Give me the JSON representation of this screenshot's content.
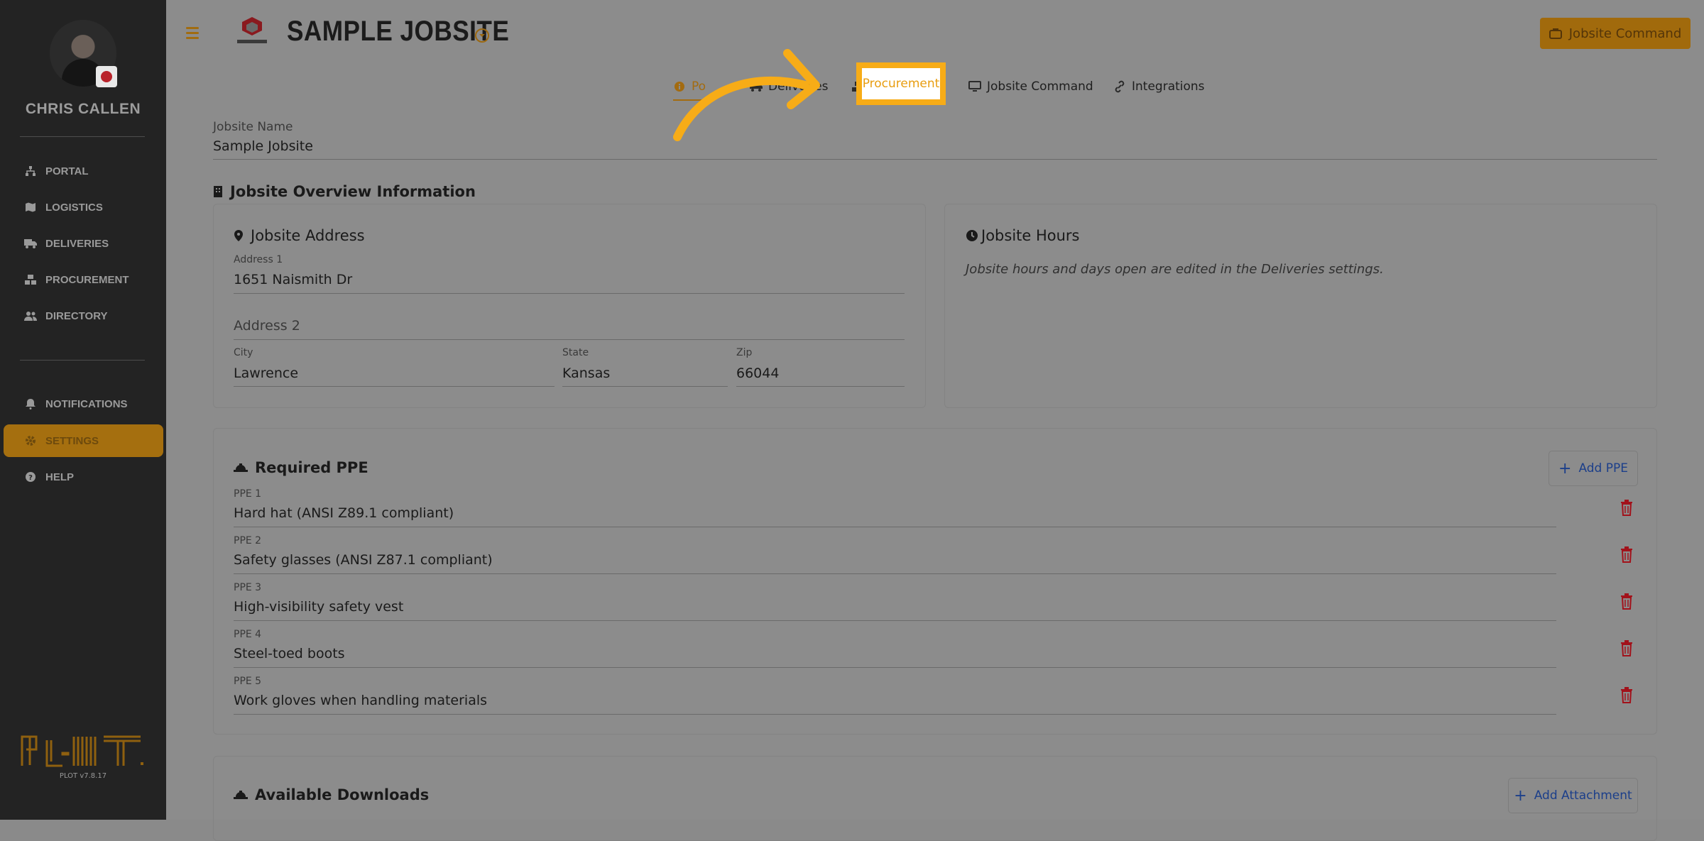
{
  "sidebar": {
    "user_name": "CHRIS CALLEN",
    "items": [
      {
        "label": "PORTAL",
        "icon": "sitemap-icon"
      },
      {
        "label": "LOGISTICS",
        "icon": "map-icon"
      },
      {
        "label": "DELIVERIES",
        "icon": "truck-icon"
      },
      {
        "label": "PROCUREMENT",
        "icon": "boxes-icon"
      },
      {
        "label": "DIRECTORY",
        "icon": "users-icon"
      },
      {
        "label": "NOTIFICATIONS",
        "icon": "bell-icon"
      },
      {
        "label": "SETTINGS",
        "icon": "gear-icon",
        "active": true
      },
      {
        "label": "HELP",
        "icon": "question-icon"
      }
    ],
    "version": "PLOT v7.8.17"
  },
  "header": {
    "title": "SAMPLE JOBSITE",
    "command_button": "Jobsite Command"
  },
  "tabs": [
    {
      "label": "Po",
      "icon": "info-icon",
      "active": true
    },
    {
      "label": "Deliveries",
      "icon": "truck-icon"
    },
    {
      "label": "Procurement",
      "icon": "boxes-icon",
      "highlighted": true
    },
    {
      "label": "Jobsite Command",
      "icon": "monitor-icon"
    },
    {
      "label": "Integrations",
      "icon": "link-icon"
    }
  ],
  "jobsite_name": {
    "label": "Jobsite Name",
    "value": "Sample Jobsite"
  },
  "overview": {
    "title": "Jobsite Overview Information",
    "address": {
      "title": "Jobsite Address",
      "address1_label": "Address 1",
      "address1": "1651 Naismith Dr",
      "address2_placeholder": "Address 2",
      "city_label": "City",
      "city": "Lawrence",
      "state_label": "State",
      "state": "Kansas",
      "zip_label": "Zip",
      "zip": "66044"
    },
    "hours": {
      "title": "Jobsite Hours",
      "note": "Jobsite hours and days open are edited in the Deliveries settings."
    }
  },
  "ppe": {
    "title": "Required PPE",
    "add_button": "Add PPE",
    "items": [
      {
        "label": "PPE 1",
        "value": "Hard hat (ANSI Z89.1 compliant)"
      },
      {
        "label": "PPE 2",
        "value": "Safety glasses (ANSI Z87.1 compliant)"
      },
      {
        "label": "PPE 3",
        "value": "High-visibility safety vest"
      },
      {
        "label": "PPE 4",
        "value": "Steel-toed boots"
      },
      {
        "label": "PPE 5",
        "value": "Work gloves when handling materials"
      }
    ]
  },
  "downloads": {
    "title": "Available Downloads",
    "add_button": "Add Attachment"
  },
  "colors": {
    "accent": "#f7ac17",
    "sidebar_bg": "#232323",
    "danger": "#a2121b",
    "link": "#1c3f8a"
  }
}
